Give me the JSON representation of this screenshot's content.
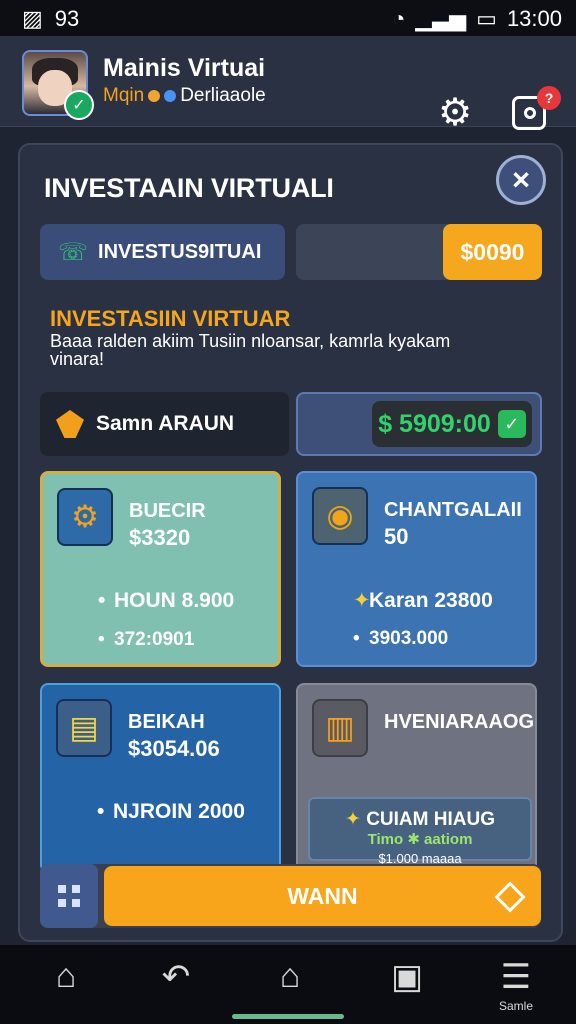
{
  "statusbar": {
    "left": "93",
    "time": "13:00"
  },
  "header": {
    "title": "Mainis Virtuai",
    "subtitle_accent": "Mqin",
    "subtitle_rest": "Derliaaole",
    "notification_count": "?"
  },
  "panel": {
    "title": "INVESTAAIN VIRTUALI",
    "search_label": "INVESTUS9ITUAI",
    "amount": "$0090",
    "section_title": "INVESTASIIN VIRTUAR",
    "description": "Baaa ralden akiim Tusiin nloansar, kamrla kyakam vinara!",
    "sam_label": "Samn ARAUN",
    "balance": "$ 5909:00"
  },
  "cards": [
    {
      "label": "BUECIR",
      "value": "$3320",
      "line1": "HOUN 8.900",
      "line2": "372:0901"
    },
    {
      "label": "CHANTGALAII",
      "value": "50",
      "line1": "Karan 23800",
      "line2": "3903.000"
    },
    {
      "label": "BEIKAH",
      "value": "$3054.06",
      "line1": "NJROIN 2000"
    },
    {
      "label": "HVENIARAAOG",
      "promo_title": "CUIAM HIAUG",
      "promo_sub": "Timo ✱ aatiom",
      "promo_cut": "$1.000 maaaa"
    }
  ],
  "cta": {
    "label": "WANN"
  },
  "bottomnav": {
    "items": [
      "",
      "",
      "",
      "",
      "Samle"
    ]
  }
}
